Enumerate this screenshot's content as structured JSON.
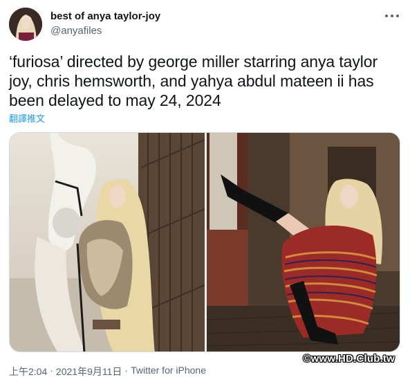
{
  "author": {
    "display_name": "best of anya taylor-joy",
    "handle": "@anyafiles",
    "avatar_icon": "profile-photo"
  },
  "more_icon": "ellipsis-icon",
  "tweet": {
    "text": "‘furiosa’ directed by george miller starring anya taylor joy, chris hemsworth, and yahya abdul mateen ii has been delayed to may 24, 2024",
    "translate_label": "翻譯推文"
  },
  "media": {
    "count": 2,
    "items": [
      {
        "subject": "woman with white horse in stable doorway"
      },
      {
        "subject": "woman in striped poncho and black boots seated by window"
      }
    ]
  },
  "meta": {
    "time": "上午2:04",
    "sep1": "·",
    "date": "2021年9月11日",
    "sep2": "·",
    "source": "Twitter for iPhone"
  },
  "watermark": "©www.HD.Club.tw",
  "colors": {
    "text": "#0f1419",
    "secondary": "#536471",
    "link": "#1d9bf0",
    "border": "#cfd9de"
  }
}
